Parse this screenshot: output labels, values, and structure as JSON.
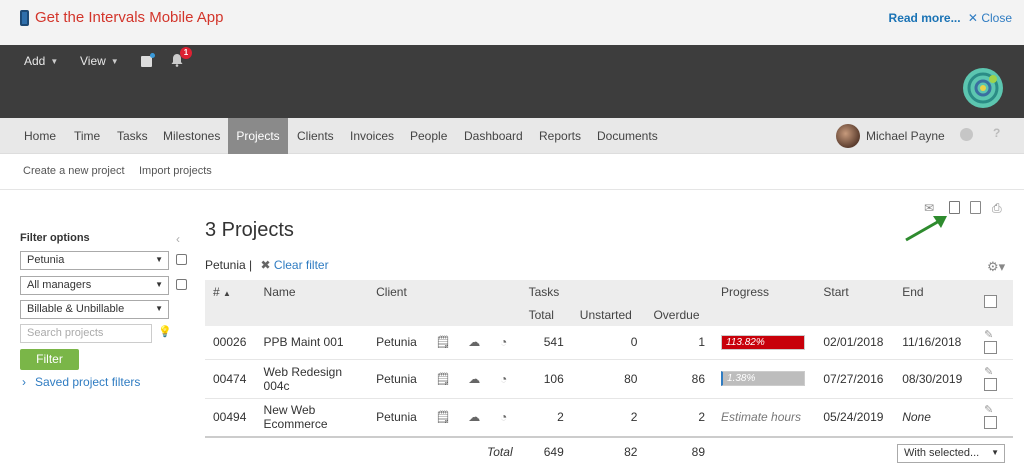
{
  "banner": {
    "app_text": "Get the Intervals Mobile App",
    "read_more": "Read more...",
    "close": "Close"
  },
  "topbar": {
    "add": "Add",
    "view": "View",
    "notifications": "1"
  },
  "nav": {
    "items": [
      "Home",
      "Time",
      "Tasks",
      "Milestones",
      "Projects",
      "Clients",
      "Invoices",
      "People",
      "Dashboard",
      "Reports",
      "Documents"
    ],
    "active": "Projects",
    "user": "Michael Payne",
    "help": "?"
  },
  "subnav": {
    "create": "Create a new project",
    "import": "Import projects"
  },
  "filters": {
    "title": "Filter options",
    "client": "Petunia",
    "managers": "All managers",
    "billable": "Billable & Unbillable",
    "search_placeholder": "Search projects",
    "filter_button": "Filter",
    "saved": "Saved project filters"
  },
  "main": {
    "title": "3 Projects",
    "breadcrumb": "Petunia |",
    "clear": "Clear filter"
  },
  "table": {
    "headers": {
      "num": "#",
      "name": "Name",
      "client": "Client",
      "tasks": "Tasks",
      "total": "Total",
      "unstarted": "Unstarted",
      "overdue": "Overdue",
      "progress": "Progress",
      "start": "Start",
      "end": "End"
    },
    "rows": [
      {
        "id": "00026",
        "name": "PPB Maint 001",
        "client": "Petunia",
        "total": "541",
        "unstarted": "0",
        "overdue": "1",
        "progress": "113.82%",
        "progress_value": 113.82,
        "progress_color": "#c8000a",
        "start": "02/01/2018",
        "end": "11/16/2018"
      },
      {
        "id": "00474",
        "name": "Web Redesign 004c",
        "client": "Petunia",
        "total": "106",
        "unstarted": "80",
        "overdue": "86",
        "progress": "1.38%",
        "progress_value": 1.38,
        "progress_color": "#bdbdbd",
        "start": "07/27/2016",
        "end": "08/30/2019"
      },
      {
        "id": "00494",
        "name": "New Web Ecommerce",
        "client": "Petunia",
        "total": "2",
        "unstarted": "2",
        "overdue": "2",
        "progress": "Estimate hours",
        "start": "05/24/2019",
        "end": "None"
      }
    ],
    "totals": {
      "label": "Total",
      "total": "649",
      "unstarted": "82",
      "overdue": "89"
    },
    "with_selected": "With selected..."
  }
}
